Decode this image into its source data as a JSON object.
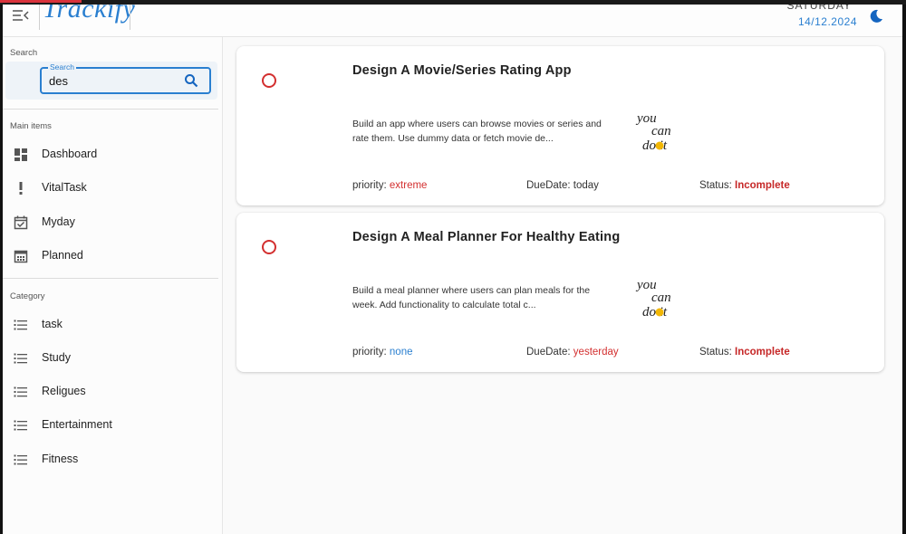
{
  "header": {
    "brand": "Trackify",
    "day": "SATURDAY",
    "date": "14/12.2024"
  },
  "sidebar": {
    "search_section": "Search",
    "search": {
      "legend": "Search",
      "value": "des"
    },
    "main_section": "Main items",
    "main_items": [
      {
        "label": "Dashboard",
        "icon": "dashboard-icon"
      },
      {
        "label": "VitalTask",
        "icon": "exclamation-icon"
      },
      {
        "label": "Myday",
        "icon": "calendar-check-icon"
      },
      {
        "label": "Planned",
        "icon": "calendar-grid-icon"
      }
    ],
    "category_section": "Category",
    "categories": [
      {
        "label": "task",
        "icon": "list-icon"
      },
      {
        "label": "Study",
        "icon": "list-icon"
      },
      {
        "label": "Religues",
        "icon": "list-icon"
      },
      {
        "label": "Entertainment",
        "icon": "list-icon"
      },
      {
        "label": "Fitness",
        "icon": "list-icon"
      }
    ]
  },
  "tasks": [
    {
      "title": "Design A Movie/Series Rating App",
      "description": "Build an app where users can browse movies or series and rate them. Use dummy data or fetch movie de...",
      "priority_label": "priority:",
      "priority": "extreme",
      "due_label": "DueDate:",
      "due": "today",
      "status_label": "Status:",
      "status": "Incomplete",
      "image_text": [
        "you",
        "can",
        "do it"
      ]
    },
    {
      "title": "Design A Meal Planner For Healthy Eating",
      "description": "Build a meal planner where users can plan meals for the week. Add functionality to calculate total c...",
      "priority_label": "priority:",
      "priority": "none",
      "due_label": "DueDate:",
      "due": "yesterday",
      "status_label": "Status:",
      "status": "Incomplete",
      "image_text": [
        "you",
        "can",
        "do it"
      ]
    }
  ],
  "colors": {
    "accent": "#2a7fd0",
    "danger": "#d32f2f",
    "priority_extreme": "#d32f2f",
    "priority_none": "#2a7fd0",
    "due_today": "#333333",
    "due_yesterday": "#d32f2f"
  }
}
